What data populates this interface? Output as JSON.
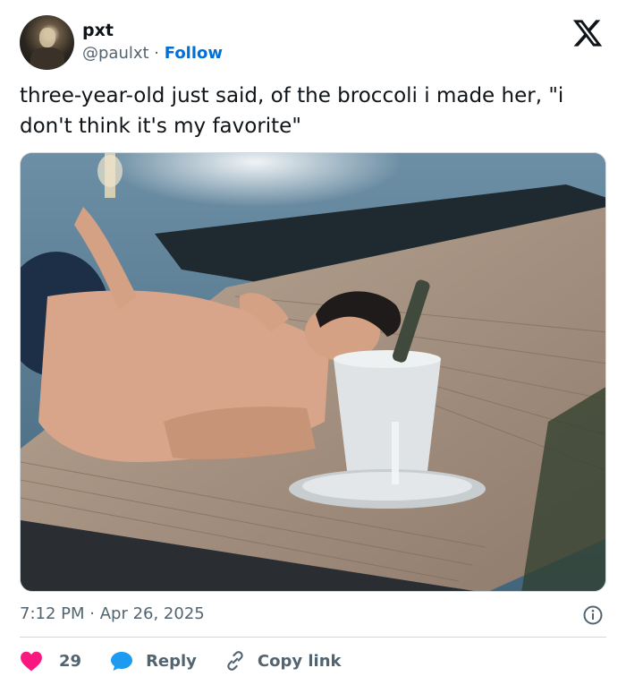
{
  "author": {
    "name": "pxt",
    "handle": "@paulxt",
    "separator": " · ",
    "follow_label": "Follow",
    "avatar_icon": "profile-photo"
  },
  "tweet": {
    "text": "three-year-old just said, of the broccoli i made her, \"i don't think it's my favorite\"",
    "time": "7:12 PM",
    "date_separator": " · ",
    "date": "Apr 26, 2025"
  },
  "media": {
    "type": "photo",
    "subject": "shirtless man lying on a boat deck holding a champagne glass beside a champagne bucket"
  },
  "actions": {
    "like_count": "29",
    "reply_label": "Reply",
    "copy_link_label": "Copy link"
  },
  "colors": {
    "like": "#f91880",
    "reply": "#1d9bf0",
    "copy": "#536471",
    "follow": "#006fd6",
    "secondary_text": "#536471"
  },
  "icons": {
    "brand": "x-logo-icon",
    "info": "info-icon",
    "like": "heart-icon",
    "reply": "speech-bubble-icon",
    "copy": "link-icon"
  }
}
